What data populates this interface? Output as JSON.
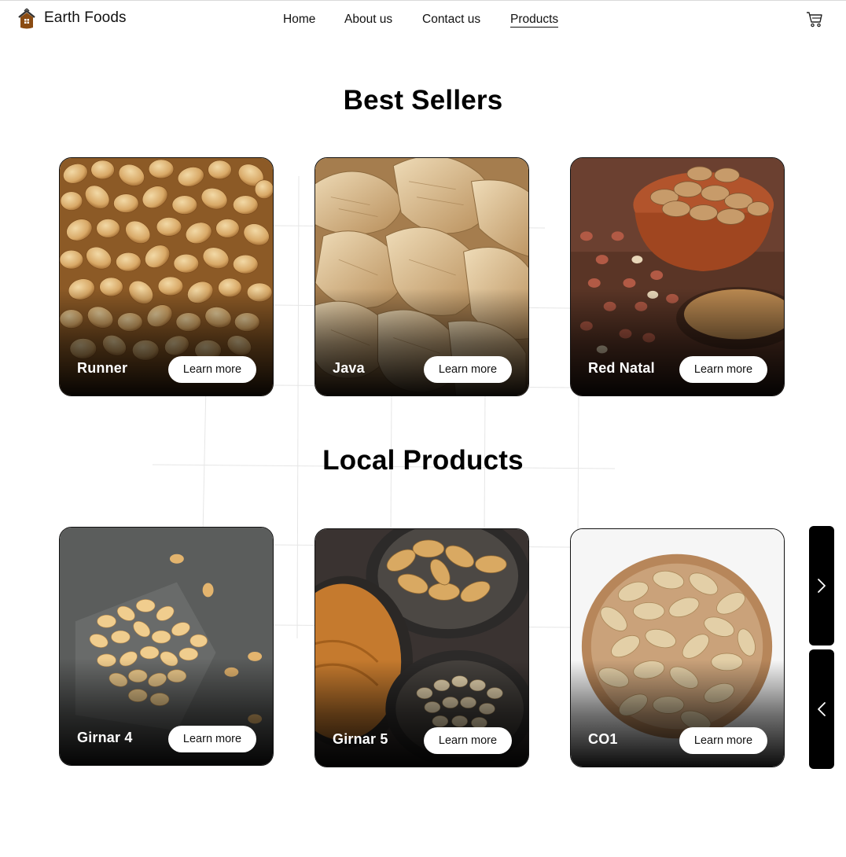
{
  "brand": {
    "name": "Earth Foods",
    "logo": "house-logo-icon"
  },
  "nav": {
    "items": [
      {
        "label": "Home"
      },
      {
        "label": "About us"
      },
      {
        "label": "Contact us"
      },
      {
        "label": "Products",
        "active": true
      }
    ],
    "cart_icon": "cart-icon"
  },
  "sections": [
    {
      "title": "Best Sellers",
      "products": [
        {
          "name": "Runner",
          "button": "Learn more"
        },
        {
          "name": "Java",
          "button": "Learn more"
        },
        {
          "name": "Red Natal",
          "button": "Learn more"
        }
      ]
    },
    {
      "title": "Local Products",
      "products": [
        {
          "name": "Girnar 4",
          "button": "Learn more"
        },
        {
          "name": "Girnar 5",
          "button": "Learn more"
        },
        {
          "name": "CO1",
          "button": "Learn more"
        }
      ]
    }
  ],
  "slider": {
    "next_icon": "chevron-right-icon",
    "prev_icon": "chevron-left-icon"
  },
  "colors": {
    "background": "#ffffff",
    "text": "#111111",
    "button_bg": "#ffffff",
    "slider_bg": "#000000",
    "logo_brown": "#8a4b12"
  }
}
